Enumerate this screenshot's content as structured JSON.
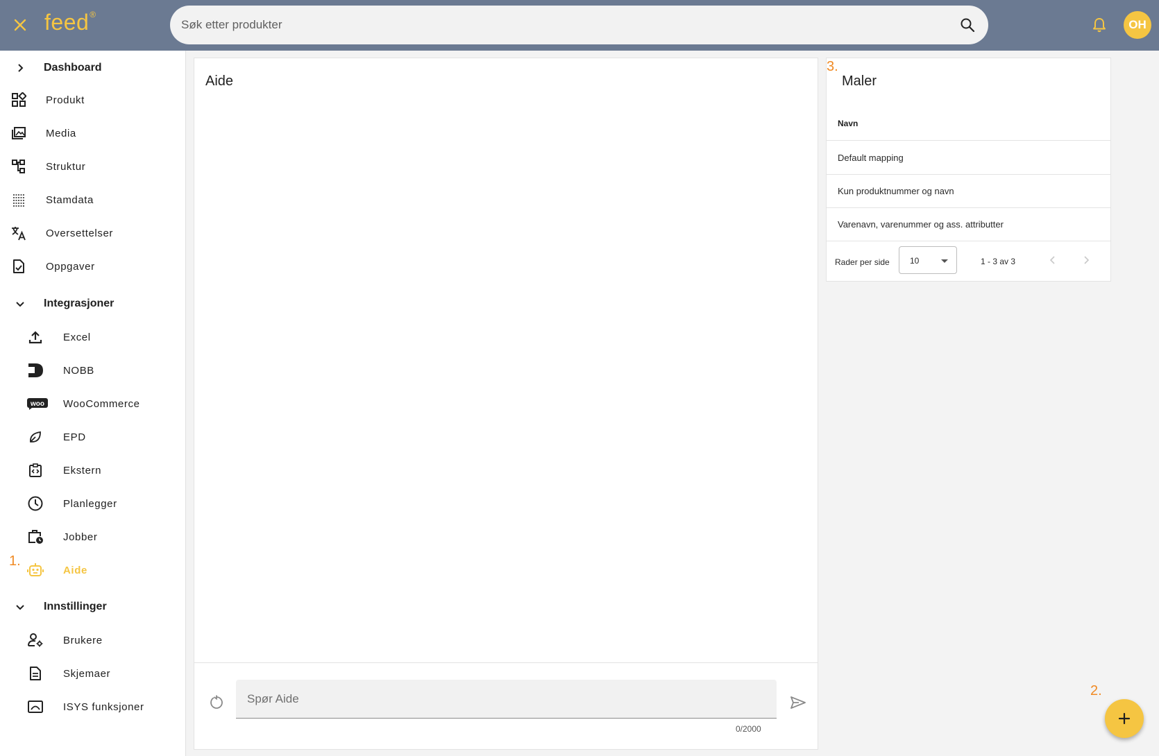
{
  "brand": {
    "logo_text": "feed",
    "logo_mark": "®",
    "accent": "#f5c542",
    "topbar_color": "#6b7a92",
    "marker_color": "#f08a24"
  },
  "search": {
    "placeholder": "Søk etter produkter"
  },
  "user": {
    "initials": "OH"
  },
  "sidebar": {
    "items": [
      {
        "label": "Dashboard",
        "icon": "chevron-right-icon"
      },
      {
        "label": "Produkt",
        "icon": "grid-icon"
      },
      {
        "label": "Media",
        "icon": "image-library-icon"
      },
      {
        "label": "Struktur",
        "icon": "tree-icon"
      },
      {
        "label": "Stamdata",
        "icon": "list-icon"
      },
      {
        "label": "Oversettelser",
        "icon": "translate-icon"
      },
      {
        "label": "Oppgaver",
        "icon": "task-icon"
      },
      {
        "label": "Integrasjoner",
        "icon": "chevron-down-icon"
      },
      {
        "label": "Excel",
        "icon": "upload-icon"
      },
      {
        "label": "NOBB",
        "icon": "nobb-icon"
      },
      {
        "label": "WooCommerce",
        "icon": "woo-icon"
      },
      {
        "label": "EPD",
        "icon": "leaf-icon"
      },
      {
        "label": "Ekstern",
        "icon": "code-clipboard-icon"
      },
      {
        "label": "Planlegger",
        "icon": "clock-icon"
      },
      {
        "label": "Jobber",
        "icon": "briefcase-clock-icon"
      },
      {
        "label": "Aide",
        "icon": "robot-icon",
        "active": true
      },
      {
        "label": "Innstillinger",
        "icon": "chevron-down-icon"
      },
      {
        "label": "Brukere",
        "icon": "user-gear-icon"
      },
      {
        "label": "Skjemaer",
        "icon": "document-icon"
      },
      {
        "label": "ISYS funksjoner",
        "icon": "window-icon"
      }
    ]
  },
  "markers": {
    "one": "1.",
    "two": "2.",
    "three": "3."
  },
  "chat": {
    "title": "Aide",
    "input_placeholder": "Spør Aide",
    "counter": "0/2000"
  },
  "templates": {
    "title": "Maler",
    "column": "Navn",
    "rows": [
      "Default mapping",
      "Kun produktnummer og navn",
      "Varenavn, varenummer og ass. attributter"
    ],
    "rows_per_page_label": "Rader per side",
    "rows_per_page_value": "10",
    "range": "1 - 3 av 3"
  }
}
